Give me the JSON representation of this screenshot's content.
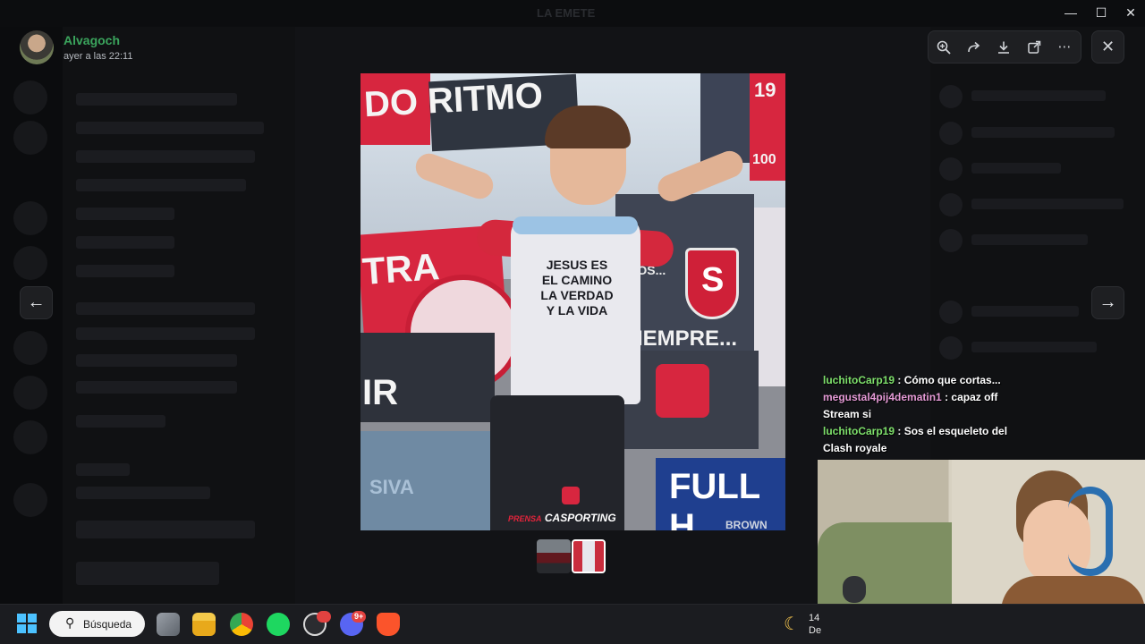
{
  "window": {
    "title": "LA EMETE"
  },
  "uploader": {
    "name": "Alvagoch",
    "time": "ayer a las 22:11"
  },
  "toolbar": {
    "zoom": "zoom-icon",
    "forward": "forward-icon",
    "download": "download-icon",
    "open_external": "external-link-icon",
    "more": "more-icon"
  },
  "image": {
    "banner_top_left": "DO RITMO",
    "banner_top_right": "19",
    "banner_right_small": "100",
    "banner_mid_left": "TRA",
    "banner_mid_right": "SIEMPRE...",
    "banner_mid_right_top": "VOS...",
    "banner_bottom_left": "IR",
    "banner_bottom_right": "FULL H",
    "banner_bottom_right_small": "BROWN",
    "banner_bottom_left_small": "SIVA",
    "shirt_lines": [
      "JESUS ES",
      "EL CAMINO",
      "LA VERDAD",
      "Y LA VIDA"
    ],
    "watermark_prefix": "PRENSA",
    "watermark": "CASPORTING"
  },
  "stream_chat": [
    {
      "user": "luchitoCarp19",
      "user_color": "#7ee06b",
      "message": ": Cómo que cortas..."
    },
    {
      "user": "megustal4pij4dematin1",
      "user_color": "#e59ad6",
      "message": ": capaz off Stream si"
    },
    {
      "user": "luchitoCarp19",
      "user_color": "#7ee06b",
      "message": ": Sos el esqueleto del Clash royale"
    }
  ],
  "taskbar": {
    "search_label": "Búsqueda",
    "discord_badge": "9+",
    "clock_line1": "14",
    "clock_line2": "De"
  },
  "colors": {
    "accent_green": "#3ba55d",
    "discord": "#5865f2",
    "brave": "#fb542b",
    "spotify": "#1ed760"
  }
}
